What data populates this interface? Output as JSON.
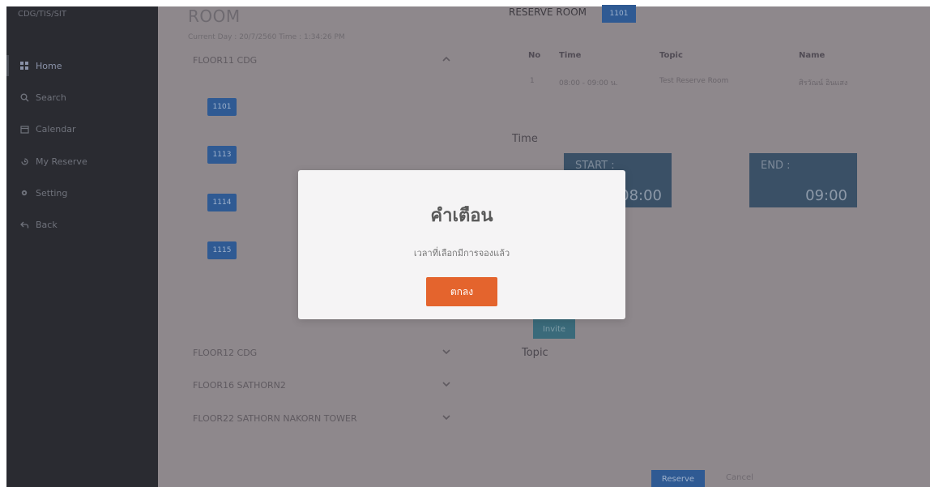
{
  "sidebar": {
    "brand": "CDG/TIS/SIT",
    "items": [
      {
        "label": "Home",
        "icon": "grid-icon"
      },
      {
        "label": "Search",
        "icon": "search-icon"
      },
      {
        "label": "Calendar",
        "icon": "calendar-icon"
      },
      {
        "label": "My Reserve",
        "icon": "history-icon"
      },
      {
        "label": "Setting",
        "icon": "gear-icon"
      },
      {
        "label": "Back",
        "icon": "back-arrow-icon"
      }
    ]
  },
  "main": {
    "title": "ROOM",
    "current": "Current   Day :  20/7/2560  Time :  1:34:26 PM"
  },
  "floors": [
    {
      "name": "FLOOR11 CDG",
      "expanded": true,
      "rooms": [
        "1101",
        "1113",
        "1114",
        "1115"
      ]
    },
    {
      "name": "FLOOR12 CDG",
      "expanded": false
    },
    {
      "name": "FLOOR16 SATHORN2",
      "expanded": false
    },
    {
      "name": "FLOOR22 SATHORN NAKORN TOWER",
      "expanded": false
    }
  ],
  "reserve": {
    "label": "RESERVE ROOM",
    "room": "1101",
    "table": {
      "headers": [
        "No",
        "Time",
        "Topic",
        "Name"
      ],
      "rows": [
        [
          "1",
          "08:00 - 09:00 น.",
          "Test Reserve Room",
          "ศิรวัณน์ อินแสง"
        ]
      ]
    },
    "time_label": "Time",
    "start_label": "START :",
    "start_value": "08:00",
    "end_label": "END :",
    "end_value": "09:00",
    "invite_label": "Invite",
    "topic_label": "Topic",
    "reserve_button": "Reserve",
    "cancel_link": "Cancel"
  },
  "modal": {
    "title": "คำเตือน",
    "message": "เวลาที่เลือกมีการจองแล้ว",
    "ok_button": "ตกลง"
  },
  "colors": {
    "overlay": "#8e888c",
    "sidebar": "#2a2b31",
    "primary": "#2f5a93",
    "time_box": "#3a5066",
    "modal_button": "#e4642d"
  }
}
